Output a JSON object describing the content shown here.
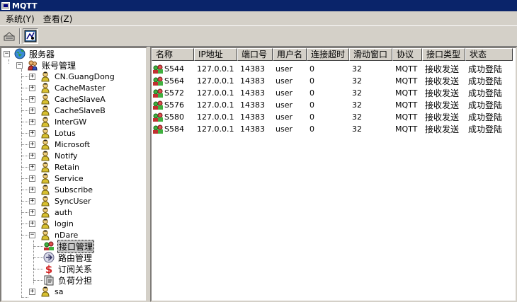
{
  "window": {
    "title": "MQTT"
  },
  "menu": [
    "系统(Y)",
    "查看(Z)"
  ],
  "toolbar": {
    "buttons": [
      "connect-icon",
      "settings-icon"
    ]
  },
  "tree": {
    "root": "服务器",
    "accounts": "账号管理",
    "nodes": [
      "CN.GuangDong",
      "CacheMaster",
      "CacheSlaveA",
      "CacheSlaveB",
      "InterGW",
      "Lotus",
      "Microsoft",
      "Notify",
      "Retain",
      "Service",
      "Subscribe",
      "SyncUser",
      "auth",
      "login",
      "nDare"
    ],
    "ndare_children": [
      "接口管理",
      "路由管理",
      "订阅关系",
      "负荷分担"
    ],
    "last_node": "sa"
  },
  "list": {
    "columns": [
      "名称",
      "IP地址",
      "端口号",
      "用户名",
      "连接超时",
      "滑动窗口",
      "协议",
      "接口类型",
      "状态"
    ],
    "rows": [
      [
        "S544",
        "127.0.0.1",
        "14383",
        "user",
        "0",
        "32",
        "MQTT",
        "接收发送",
        "成功登陆"
      ],
      [
        "S564",
        "127.0.0.1",
        "14383",
        "user",
        "0",
        "32",
        "MQTT",
        "接收发送",
        "成功登陆"
      ],
      [
        "S572",
        "127.0.0.1",
        "14383",
        "user",
        "0",
        "32",
        "MQTT",
        "接收发送",
        "成功登陆"
      ],
      [
        "S576",
        "127.0.0.1",
        "14383",
        "user",
        "0",
        "32",
        "MQTT",
        "接收发送",
        "成功登陆"
      ],
      [
        "S580",
        "127.0.0.1",
        "14383",
        "user",
        "0",
        "32",
        "MQTT",
        "接收发送",
        "成功登陆"
      ],
      [
        "S584",
        "127.0.0.1",
        "14383",
        "user",
        "0",
        "32",
        "MQTT",
        "接收发送",
        "成功登陆"
      ]
    ]
  },
  "colors": {
    "titlebar": "#0a246a",
    "face": "#d4d0c8",
    "selection": "#c8c8c8"
  }
}
